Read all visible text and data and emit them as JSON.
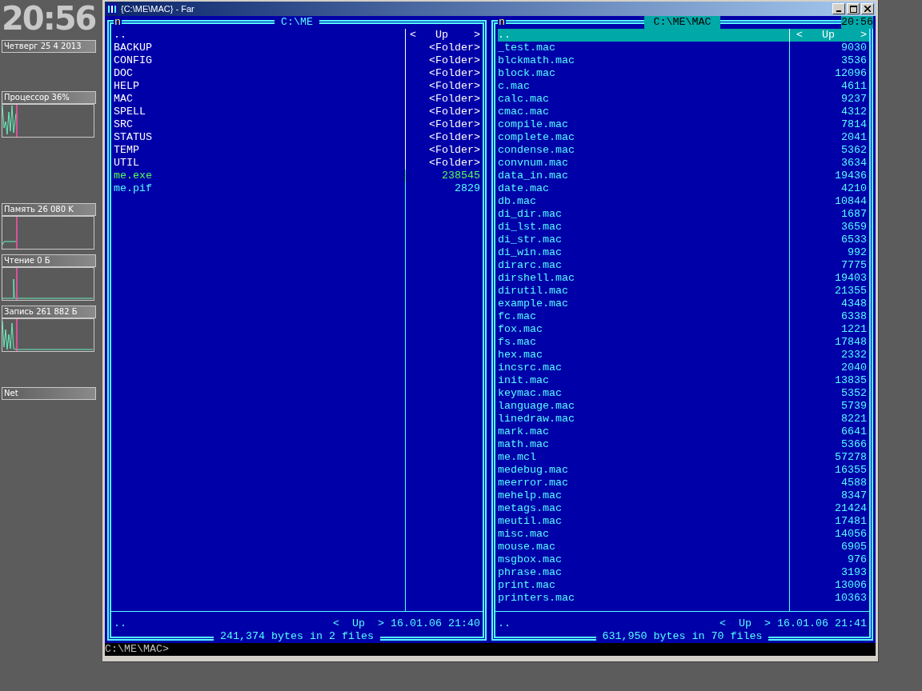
{
  "desktop": {
    "clock": "20:56",
    "date": "Четверг 25 4 2013",
    "monitors": [
      {
        "label": "Процессор 36%",
        "kind": "graph"
      },
      {
        "label": "Память 26 080 K",
        "kind": "graph"
      },
      {
        "label": "Чтение 0 Б",
        "kind": "graph"
      },
      {
        "label": "Запись 261 882 Б",
        "kind": "graph"
      },
      {
        "label": "Net",
        "kind": "label"
      }
    ]
  },
  "window": {
    "title": "{C:\\ME\\MAC} - Far"
  },
  "panels": [
    {
      "sort_mark": "n",
      "path": "C:\\ME",
      "active": false,
      "entries": [
        {
          "name": "..",
          "size": "<   Up    >",
          "kind": "up",
          "selected": false
        },
        {
          "name": "BACKUP",
          "size": "<Folder>",
          "kind": "folder",
          "selected": false
        },
        {
          "name": "CONFIG",
          "size": "<Folder>",
          "kind": "folder",
          "selected": false
        },
        {
          "name": "DOC",
          "size": "<Folder>",
          "kind": "folder",
          "selected": false
        },
        {
          "name": "HELP",
          "size": "<Folder>",
          "kind": "folder",
          "selected": false
        },
        {
          "name": "MAC",
          "size": "<Folder>",
          "kind": "folder",
          "selected": false
        },
        {
          "name": "SPELL",
          "size": "<Folder>",
          "kind": "folder",
          "selected": false
        },
        {
          "name": "SRC",
          "size": "<Folder>",
          "kind": "folder",
          "selected": false
        },
        {
          "name": "STATUS",
          "size": "<Folder>",
          "kind": "folder",
          "selected": false
        },
        {
          "name": "TEMP",
          "size": "<Folder>",
          "kind": "folder",
          "selected": false
        },
        {
          "name": "UTIL",
          "size": "<Folder>",
          "kind": "folder",
          "selected": false
        },
        {
          "name": "me.exe",
          "size": "238545",
          "kind": "exe",
          "selected": false
        },
        {
          "name": "me.pif",
          "size": "2829",
          "kind": "file",
          "selected": false
        }
      ],
      "info": {
        "name": "..",
        "size": "<  Up  >",
        "date": "16.01.06",
        "time": "21:40"
      },
      "total": "241,374 bytes in 2 files"
    },
    {
      "sort_mark": "n",
      "path": "C:\\ME\\MAC",
      "active": true,
      "clock": "20:56",
      "entries": [
        {
          "name": "..",
          "size": "<   Up    >",
          "kind": "up",
          "selected": true
        },
        {
          "name": "_test.mac",
          "size": "9030",
          "kind": "file",
          "selected": false
        },
        {
          "name": "blckmath.mac",
          "size": "3536",
          "kind": "file",
          "selected": false
        },
        {
          "name": "block.mac",
          "size": "12096",
          "kind": "file",
          "selected": false
        },
        {
          "name": "c.mac",
          "size": "4611",
          "kind": "file",
          "selected": false
        },
        {
          "name": "calc.mac",
          "size": "9237",
          "kind": "file",
          "selected": false
        },
        {
          "name": "cmac.mac",
          "size": "4312",
          "kind": "file",
          "selected": false
        },
        {
          "name": "compile.mac",
          "size": "7814",
          "kind": "file",
          "selected": false
        },
        {
          "name": "complete.mac",
          "size": "2041",
          "kind": "file",
          "selected": false
        },
        {
          "name": "condense.mac",
          "size": "5362",
          "kind": "file",
          "selected": false
        },
        {
          "name": "convnum.mac",
          "size": "3634",
          "kind": "file",
          "selected": false
        },
        {
          "name": "data_in.mac",
          "size": "19436",
          "kind": "file",
          "selected": false
        },
        {
          "name": "date.mac",
          "size": "4210",
          "kind": "file",
          "selected": false
        },
        {
          "name": "db.mac",
          "size": "10844",
          "kind": "file",
          "selected": false
        },
        {
          "name": "di_dir.mac",
          "size": "1687",
          "kind": "file",
          "selected": false
        },
        {
          "name": "di_lst.mac",
          "size": "3659",
          "kind": "file",
          "selected": false
        },
        {
          "name": "di_str.mac",
          "size": "6533",
          "kind": "file",
          "selected": false
        },
        {
          "name": "di_win.mac",
          "size": "992",
          "kind": "file",
          "selected": false
        },
        {
          "name": "dirarc.mac",
          "size": "7775",
          "kind": "file",
          "selected": false
        },
        {
          "name": "dirshell.mac",
          "size": "19403",
          "kind": "file",
          "selected": false
        },
        {
          "name": "dirutil.mac",
          "size": "21355",
          "kind": "file",
          "selected": false
        },
        {
          "name": "example.mac",
          "size": "4348",
          "kind": "file",
          "selected": false
        },
        {
          "name": "fc.mac",
          "size": "6338",
          "kind": "file",
          "selected": false
        },
        {
          "name": "fox.mac",
          "size": "1221",
          "kind": "file",
          "selected": false
        },
        {
          "name": "fs.mac",
          "size": "17848",
          "kind": "file",
          "selected": false
        },
        {
          "name": "hex.mac",
          "size": "2332",
          "kind": "file",
          "selected": false
        },
        {
          "name": "incsrc.mac",
          "size": "2040",
          "kind": "file",
          "selected": false
        },
        {
          "name": "init.mac",
          "size": "13835",
          "kind": "file",
          "selected": false
        },
        {
          "name": "keymac.mac",
          "size": "5352",
          "kind": "file",
          "selected": false
        },
        {
          "name": "language.mac",
          "size": "5739",
          "kind": "file",
          "selected": false
        },
        {
          "name": "linedraw.mac",
          "size": "8221",
          "kind": "file",
          "selected": false
        },
        {
          "name": "mark.mac",
          "size": "6641",
          "kind": "file",
          "selected": false
        },
        {
          "name": "math.mac",
          "size": "5366",
          "kind": "file",
          "selected": false
        },
        {
          "name": "me.mcl",
          "size": "57278",
          "kind": "file",
          "selected": false
        },
        {
          "name": "medebug.mac",
          "size": "16355",
          "kind": "file",
          "selected": false
        },
        {
          "name": "meerror.mac",
          "size": "4588",
          "kind": "file",
          "selected": false
        },
        {
          "name": "mehelp.mac",
          "size": "8347",
          "kind": "file",
          "selected": false
        },
        {
          "name": "metags.mac",
          "size": "21424",
          "kind": "file",
          "selected": false
        },
        {
          "name": "meutil.mac",
          "size": "17481",
          "kind": "file",
          "selected": false
        },
        {
          "name": "misc.mac",
          "size": "14056",
          "kind": "file",
          "selected": false
        },
        {
          "name": "mouse.mac",
          "size": "6905",
          "kind": "file",
          "selected": false
        },
        {
          "name": "msgbox.mac",
          "size": "976",
          "kind": "file",
          "selected": false
        },
        {
          "name": "phrase.mac",
          "size": "3193",
          "kind": "file",
          "selected": false
        },
        {
          "name": "print.mac",
          "size": "13006",
          "kind": "file",
          "selected": false
        },
        {
          "name": "printers.mac",
          "size": "10363",
          "kind": "file",
          "selected": false
        }
      ],
      "info": {
        "name": "..",
        "size": "<  Up  >",
        "date": "16.01.06",
        "time": "21:41"
      },
      "total": "631,950 bytes in 70 files"
    }
  ],
  "command_line": {
    "prompt": "C:\\ME\\MAC>"
  }
}
